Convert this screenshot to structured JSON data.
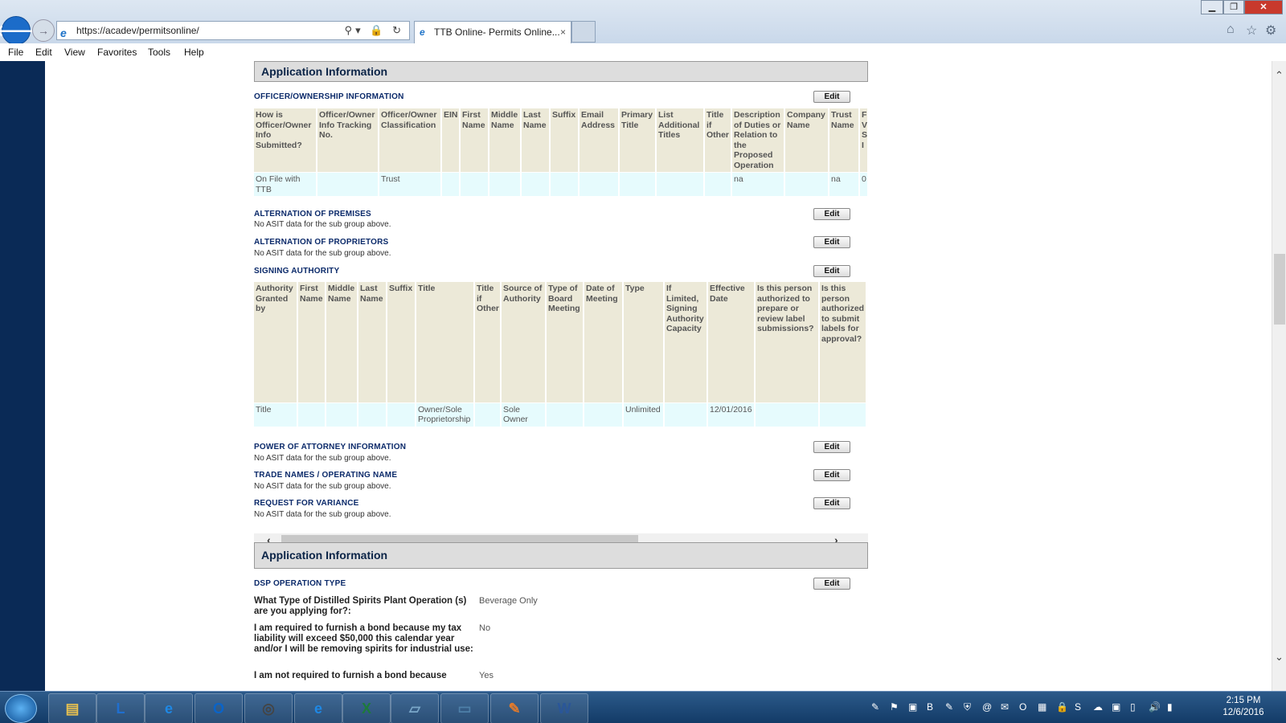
{
  "browser": {
    "url": "https://acadev/permitsonline/",
    "tab_title": "TTB Online- Permits Online...",
    "tab_close": "×",
    "close_glyph": "✕",
    "max_glyph": "❐",
    "min_glyph": "▁",
    "back_glyph": "🡐",
    "fwd_glyph": "→",
    "addr_tools": "⚲▾ 🔒 ↻",
    "home_glyph": "⌂",
    "fav_glyph": "☆",
    "gear_glyph": "⚙"
  },
  "menu": [
    "File",
    "Edit",
    "View",
    "Favorites",
    "Tools",
    "Help"
  ],
  "page": {
    "section1_title": "Application Information",
    "edit_label": "Edit",
    "no_data": "No ASIT data for the sub group above.",
    "officer": {
      "label": "OFFICER/OWNERSHIP INFORMATION",
      "headers": [
        "How is Officer/Owner Info Submitted?",
        "Officer/Owner Info Tracking No.",
        "Officer/Owner Classification",
        "EIN",
        "First Name",
        "Middle Name",
        "Last Name",
        "Suffix",
        "Email Address",
        "Primary Title",
        "List Additional Titles",
        "Title if Other",
        "Description of Duties or Relation to the Proposed Operation",
        "Company Name",
        "Trust Name",
        "F V S I"
      ],
      "row": [
        "On File with TTB",
        "",
        "Trust",
        "",
        "",
        "",
        "",
        "",
        "",
        "",
        "",
        "",
        "na",
        "",
        "na",
        "0"
      ]
    },
    "alt_premises": "ALTERNATION OF PREMISES",
    "alt_proprietors": "ALTERNATION OF PROPRIETORS",
    "signing": {
      "label": "SIGNING AUTHORITY",
      "headers": [
        "Authority Granted by",
        "First Name",
        "Middle Name",
        "Last Name",
        "Suffix",
        "Title",
        "Title if Other",
        "Source of Authority",
        "Type of Board Meeting",
        "Date of Meeting",
        "Type",
        "If Limited, Signing Authority Capacity",
        "Effective Date",
        "Is this person authorized to prepare or review label submissions?",
        "Is this person authorized to submit labels for approval?"
      ],
      "row": [
        "Title",
        "",
        "",
        "",
        "",
        "Owner/Sole Proprietorship",
        "",
        "Sole Owner",
        "",
        "",
        "Unlimited",
        "",
        "12/01/2016",
        "",
        ""
      ]
    },
    "power_attorney": "POWER OF ATTORNEY INFORMATION",
    "trade_names": "TRADE NAMES / OPERATING NAME",
    "variance": "REQUEST FOR VARIANCE",
    "section2_title": "Application Information",
    "dsp": {
      "label": "DSP OPERATION TYPE",
      "q1": "What Type of Distilled Spirits Plant Operation (s) are you applying for?:",
      "a1": "Beverage Only",
      "q2": "I am required to furnish a bond because my tax liability will exceed $50,000 this calendar year and/or I will be removing spirits for industrial use:",
      "a2": "No",
      "q3": "I am not required to furnish a bond because",
      "a3": "Yes"
    },
    "hscroll_left": "‹",
    "hscroll_right": "›",
    "vscroll_up": "⌃",
    "vscroll_down": "⌄"
  },
  "taskbar": {
    "icons": [
      "file-explorer",
      "lync",
      "internet-explorer",
      "outlook",
      "app-circle",
      "internet-explorer-2",
      "excel",
      "notepad",
      "photos",
      "paint",
      "word"
    ],
    "icon_glyphs": [
      "▤",
      "L",
      "e",
      "O",
      "◎",
      "e",
      "X",
      "▱",
      "▭",
      "✎",
      "W"
    ],
    "icon_colors": [
      "#e8c150",
      "#1f6fd0",
      "#1e88e5",
      "#0a64c9",
      "#444444",
      "#1e88e5",
      "#1d7a3a",
      "#7aa7c9",
      "#4e7fa8",
      "#e07a2c",
      "#2a5699"
    ],
    "tray_glyphs": [
      "✎",
      "⚑",
      "▣",
      "B",
      "✎",
      "⛨",
      "@",
      "✉",
      "O",
      "▦",
      "🔒",
      "S",
      "☁",
      "▣",
      "▯",
      "🔊",
      "▮"
    ],
    "time": "2:15 PM",
    "date": "12/6/2016"
  }
}
